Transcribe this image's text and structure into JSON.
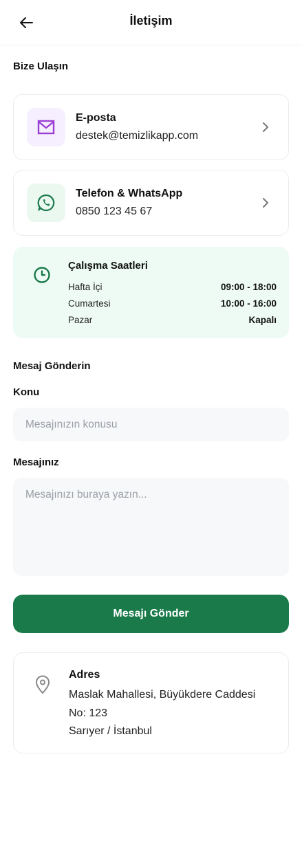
{
  "header": {
    "title": "İletişim"
  },
  "contact_section": {
    "title": "Bize Ulaşın"
  },
  "contacts": [
    {
      "title": "E-posta",
      "value": "destek@temizlikapp.com",
      "icon": "mail-icon",
      "color": "#9b3fd4",
      "bg": "#f6efff"
    },
    {
      "title": "Telefon & WhatsApp",
      "value": "0850 123 45 67",
      "icon": "whatsapp-icon",
      "color": "#1a7a4a",
      "bg": "#eaf8f0"
    }
  ],
  "hours": {
    "title": "Çalışma Saatleri",
    "rows": [
      {
        "day": "Hafta İçi",
        "time": "09:00 - 18:00"
      },
      {
        "day": "Cumartesi",
        "time": "10:00 - 16:00"
      },
      {
        "day": "Pazar",
        "time": "Kapalı"
      }
    ]
  },
  "form": {
    "title": "Mesaj Gönderin",
    "subject_label": "Konu",
    "subject_placeholder": "Mesajınızın konusu",
    "message_label": "Mesajınız",
    "message_placeholder": "Mesajınızı buraya yazın...",
    "submit_label": "Mesajı Gönder"
  },
  "address": {
    "title": "Adres",
    "lines": [
      "Maslak Mahallesi, Büyükdere Caddesi",
      "No: 123",
      "Sarıyer / İstanbul"
    ]
  },
  "colors": {
    "primary": "#1a7a4a",
    "hours_bg": "#eefbf5",
    "input_bg": "#f7f8fa"
  }
}
